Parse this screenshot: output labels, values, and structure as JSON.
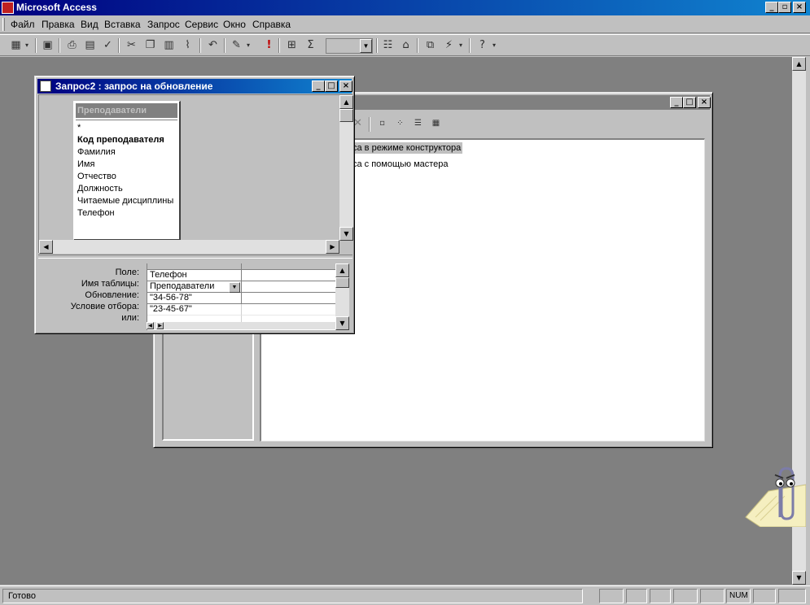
{
  "app": {
    "title": "Microsoft Access"
  },
  "titlebar_buttons": {
    "minimize": "_",
    "restore": "▫",
    "close": "×"
  },
  "menu": [
    "Файл",
    "Правка",
    "Вид",
    "Вставка",
    "Запрос",
    "Сервис",
    "Окно",
    "Справка"
  ],
  "toolbar": {
    "icons": [
      "view-icon",
      "save-icon",
      "print-icon",
      "print-preview-icon",
      "spelling-icon",
      "cut-icon",
      "copy-icon",
      "paste-icon",
      "format-painter-icon",
      "undo-icon",
      "query-type-icon",
      "run-icon",
      "show-table-icon",
      "totals-icon",
      "properties-icon",
      "build-icon",
      "database-window-icon",
      "new-object-icon",
      "help-icon"
    ]
  },
  "query_window": {
    "title": "Запрос2 : запрос на обновление",
    "table": {
      "name": "Преподаватели",
      "fields": [
        "*",
        "Код преподавателя",
        "Фамилия",
        "Имя",
        "Отчество",
        "Должность",
        "Читаемые дисциплины",
        "Телефон"
      ]
    },
    "grid": {
      "row_labels": [
        "Поле:",
        "Имя таблицы:",
        "Обновление:",
        "Условие отбора:",
        "или:"
      ],
      "column1": {
        "field": "Телефон",
        "table": "Преподаватели",
        "update": "\"34-56-78\"",
        "criteria": "\"23-45-67\"",
        "or": ""
      }
    }
  },
  "db_window": {
    "items": [
      "са в режиме конструктора",
      "са с помощью мастера"
    ]
  },
  "status": {
    "text": "Готово",
    "num": "NUM"
  },
  "colors": {
    "title_active": "#000080",
    "title_inactive": "#808080",
    "mdi_background": "#808080",
    "face": "#c0c0c0"
  }
}
